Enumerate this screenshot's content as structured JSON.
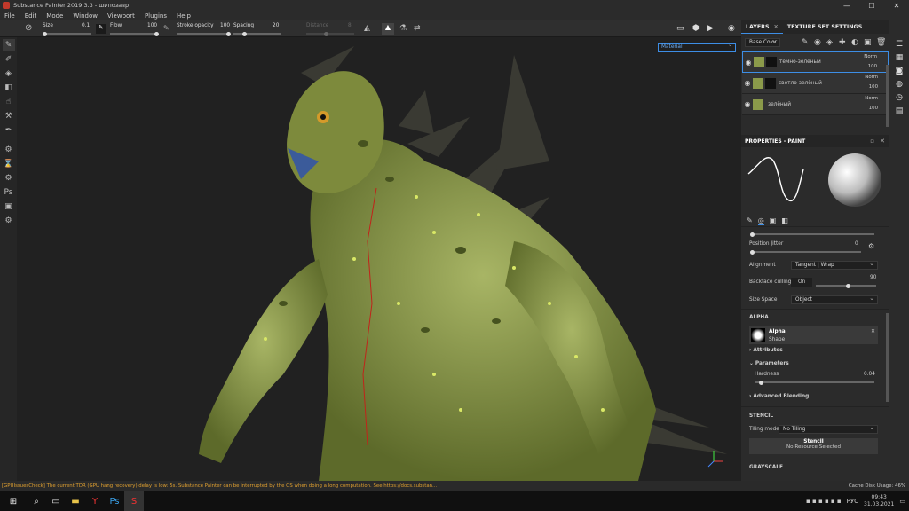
{
  "window": {
    "title": "Substance Painter 2019.3.3 - шипозавр",
    "min": "—",
    "max": "☐",
    "close": "✕"
  },
  "menu": [
    "File",
    "Edit",
    "Mode",
    "Window",
    "Viewport",
    "Plugins",
    "Help"
  ],
  "toolbar": {
    "size_label": "Size",
    "size_value": "0.1",
    "flow_label": "Flow",
    "flow_value": "100",
    "stroke_opacity_label": "Stroke opacity",
    "stroke_opacity_value": "100",
    "spacing_label": "Spacing",
    "spacing_value": "20",
    "distance_label": "Distance",
    "distance_value": "8"
  },
  "viewport": {
    "mode": "Material"
  },
  "layers_panel": {
    "tab_layers": "LAYERS",
    "tab_texture": "TEXTURE SET SETTINGS",
    "channel": "Base Color",
    "layers": [
      {
        "name": "тёмно-зелёный",
        "blend": "Norm",
        "opacity": "100",
        "selected": true
      },
      {
        "name": "светло-зелёный",
        "blend": "Norm",
        "opacity": "100",
        "selected": false
      },
      {
        "name": "зелёный",
        "blend": "Norm",
        "opacity": "100",
        "selected": false
      }
    ]
  },
  "properties": {
    "title": "PROPERTIES - PAINT",
    "position_jitter_label": "Position Jitter",
    "position_jitter_value": "0",
    "alignment_label": "Alignment",
    "alignment_value": "Tangent | Wrap",
    "backface_label": "Backface culling",
    "backface_value": "On",
    "backface_num": "90",
    "size_space_label": "Size Space",
    "size_space_value": "Object",
    "alpha_section": "ALPHA",
    "alpha_name": "Alpha",
    "alpha_type": "Shape",
    "attributes": "Attributes",
    "parameters": "Parameters",
    "hardness_label": "Hardness",
    "hardness_value": "0.04",
    "advanced": "Advanced Blending",
    "stencil_section": "STENCIL",
    "tiling_label": "Tiling mode",
    "tiling_value": "No Tiling",
    "stencil_btn": "Stencil",
    "stencil_sub": "No Resource Selected",
    "grayscale_section": "GRAYSCALE"
  },
  "status": {
    "message": "[GPUIssuesCheck] The current TDR (GPU hang recovery) delay is low: 5s. Substance Painter can be interrupted by the OS when doing a long computation. See https://docs.substan...",
    "cache": "Cache Disk Usage:   46%"
  },
  "taskbar": {
    "lang": "РУС",
    "time": "09:43",
    "date": "31.03.2021"
  },
  "colors": {
    "accent": "#3d8ee6",
    "warning": "#e0a030",
    "creature": "#8b9a4a"
  }
}
